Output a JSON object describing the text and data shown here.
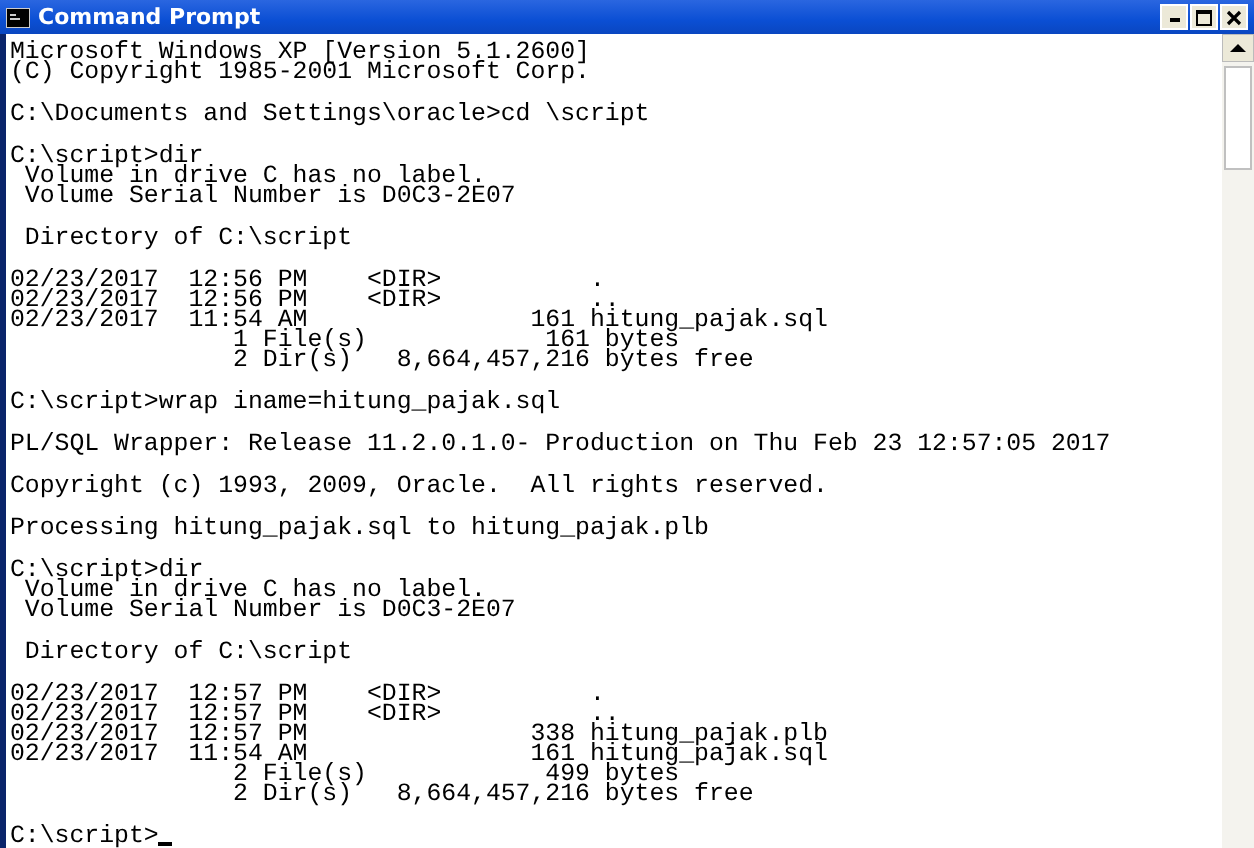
{
  "window": {
    "title": "Command Prompt"
  },
  "console": {
    "blocks": [
      [
        "Microsoft Windows XP [Version 5.1.2600]",
        "(C) Copyright 1985-2001 Microsoft Corp."
      ],
      [
        "C:\\Documents and Settings\\oracle>cd \\script"
      ],
      [
        "C:\\script>dir",
        " Volume in drive C has no label.",
        " Volume Serial Number is D0C3-2E07"
      ],
      [
        " Directory of C:\\script"
      ],
      [
        "02/23/2017  12:56 PM    <DIR>          .",
        "02/23/2017  12:56 PM    <DIR>          ..",
        "02/23/2017  11:54 AM               161 hitung_pajak.sql",
        "               1 File(s)            161 bytes",
        "               2 Dir(s)   8,664,457,216 bytes free"
      ],
      [
        "C:\\script>wrap iname=hitung_pajak.sql"
      ],
      [
        "PL/SQL Wrapper: Release 11.2.0.1.0- Production on Thu Feb 23 12:57:05 2017"
      ],
      [
        "Copyright (c) 1993, 2009, Oracle.  All rights reserved."
      ],
      [
        "Processing hitung_pajak.sql to hitung_pajak.plb"
      ],
      [
        "C:\\script>dir",
        " Volume in drive C has no label.",
        " Volume Serial Number is D0C3-2E07"
      ],
      [
        " Directory of C:\\script"
      ],
      [
        "02/23/2017  12:57 PM    <DIR>          .",
        "02/23/2017  12:57 PM    <DIR>          ..",
        "02/23/2017  12:57 PM               338 hitung_pajak.plb",
        "02/23/2017  11:54 AM               161 hitung_pajak.sql",
        "               2 File(s)            499 bytes",
        "               2 Dir(s)   8,664,457,216 bytes free"
      ],
      [
        "C:\\script>"
      ]
    ],
    "cursor_visible": true
  }
}
